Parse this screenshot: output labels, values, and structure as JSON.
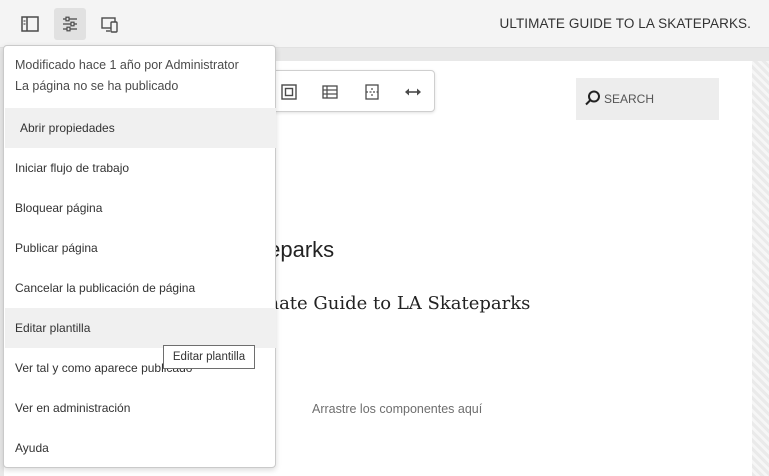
{
  "topbar": {
    "page_title": "ULTIMATE GUIDE TO LA SKATEPARKS.",
    "icons": [
      "side-panel-icon",
      "page-properties-icon",
      "emulator-icon"
    ]
  },
  "canvas": {
    "search_placeholder": "SEARCH",
    "heading1": "teparks",
    "heading2": "mate Guide to LA Skateparks",
    "dropzone": "Arrastre los componentes aquí"
  },
  "page_menu": {
    "modified": "Modificado hace 1 año por Administrator",
    "published": "La página no se ha publicado",
    "items": [
      {
        "label": "Abrir propiedades",
        "highlighted": true
      },
      {
        "label": "Iniciar flujo de trabajo"
      },
      {
        "label": "Bloquear página"
      },
      {
        "label": "Publicar página"
      },
      {
        "label": "Cancelar la publicación de página"
      },
      {
        "label": "Editar plantilla",
        "highlighted": true
      },
      {
        "label": "Ver tal y como aparece publicado"
      },
      {
        "label": "Ver en administración"
      },
      {
        "label": "Ayuda"
      }
    ]
  },
  "tooltip": "Editar plantilla",
  "component_toolbar": {
    "icons": [
      "select-parent-icon",
      "table-icon",
      "layout-icon",
      "resize-icon"
    ]
  },
  "colors": {
    "topbar_bg": "#f4f4f4",
    "active_button_bg": "#e1e1e1",
    "highlight_bg": "#f0f0f0",
    "search_bg": "#ededed"
  }
}
